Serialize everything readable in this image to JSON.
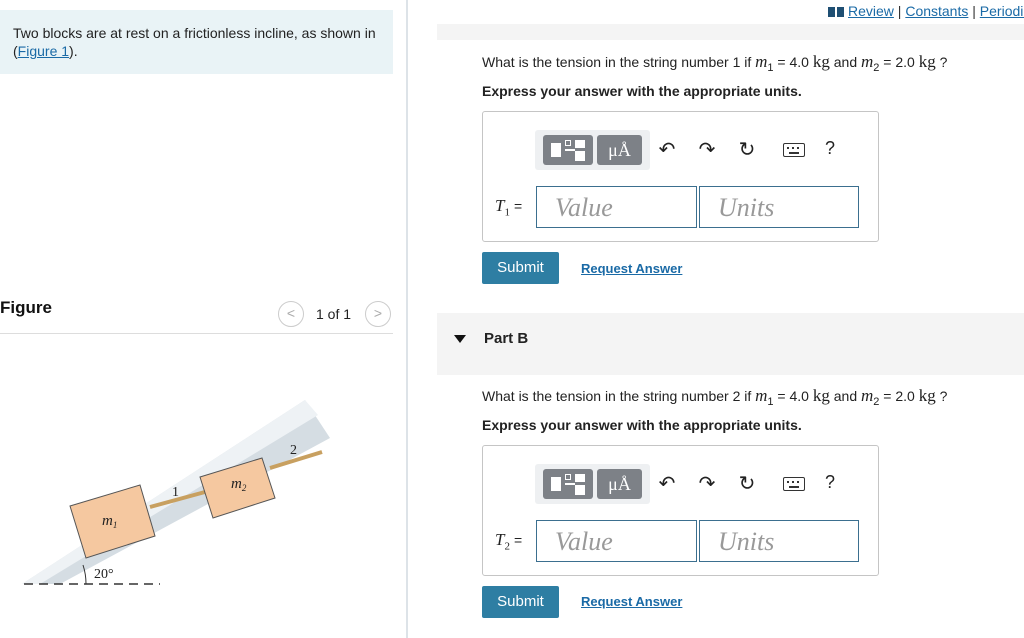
{
  "problem": {
    "text_before": "Two blocks are at rest on a frictionless incline, as shown in (",
    "link": "Figure 1",
    "text_after": ")."
  },
  "figure": {
    "title": "Figure",
    "count": "1 of 1",
    "prev": "<",
    "next": ">",
    "labels": {
      "m1": "m",
      "m1_sub": "1",
      "m2": "m",
      "m2_sub": "2",
      "string1": "1",
      "string2": "2",
      "angle": "20°"
    }
  },
  "toplinks": {
    "review": "Review",
    "sep": " | ",
    "constants": "Constants",
    "periodic": "Periodic"
  },
  "partA": {
    "q_prefix": "What is the tension in the string number 1 if ",
    "m1": "m",
    "m1_sub": "1",
    "m1_val": " = 4.0 ",
    "unit": "kg",
    "and": " and ",
    "m2": "m",
    "m2_sub": "2",
    "m2_val": " = 2.0 ",
    "q_suffix": " ?",
    "instruction": "Express your answer with the appropriate units.",
    "label": "T",
    "label_sub": "1",
    "value_placeholder": "Value",
    "units_placeholder": "Units",
    "submit": "Submit",
    "request": "Request Answer"
  },
  "partB": {
    "title": "Part B",
    "q_prefix": "What is the tension in the string number 2 if ",
    "m1": "m",
    "m1_sub": "1",
    "m1_val": " = 4.0 ",
    "unit": "kg",
    "and": " and ",
    "m2": "m",
    "m2_sub": "2",
    "m2_val": " = 2.0 ",
    "q_suffix": " ?",
    "instruction": "Express your answer with the appropriate units.",
    "label": "T",
    "label_sub": "2",
    "value_placeholder": "Value",
    "units_placeholder": "Units",
    "submit": "Submit",
    "request": "Request Answer"
  },
  "toolbar": {
    "mu_label": "μÅ",
    "help": "?"
  },
  "icons": [
    "template-icon",
    "units-icon",
    "undo-icon",
    "redo-icon",
    "reset-icon",
    "keyboard-icon",
    "help-icon"
  ],
  "colors": {
    "accent": "#2e7ea3",
    "link": "#1a6aa6",
    "problem_bg": "#e9f3f6",
    "block": "#f5c8a0"
  }
}
